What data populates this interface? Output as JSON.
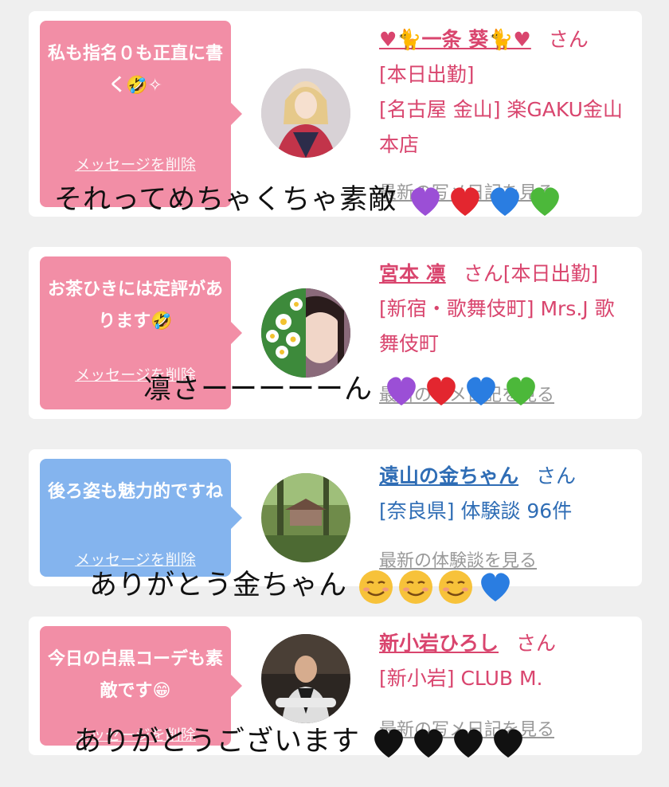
{
  "cards": [
    {
      "message": "私も指名０も正直に書く🤣✧",
      "delete_label": "メッセージを削除",
      "name": "♥🐈一条 葵🐈♥",
      "suffix": "さん",
      "status": "[本日出勤]",
      "location": "[名古屋 金山] 楽GAKU金山本店",
      "link": "最新の写メ日記を見る",
      "bubble_color": "#f28ea6"
    },
    {
      "message": "お茶ひきには定評があります🤣",
      "delete_label": "メッセージを削除",
      "name": "宮本 凛",
      "suffix": "さん",
      "status": "[本日出勤]",
      "location": "[新宿・歌舞伎町] Mrs.J 歌舞伎町",
      "link": "最新の写メ日記を見る",
      "bubble_color": "#f28ea6"
    },
    {
      "message": "後ろ姿も魅力的ですね",
      "delete_label": "メッセージを削除",
      "name": "遠山の金ちゃん",
      "suffix": "さん",
      "location": "[奈良県] 体験談 96件",
      "link": "最新の体験談を見る",
      "bubble_color": "#84b4ee"
    },
    {
      "message": "今日の白黒コーデも素敵です😁",
      "delete_label": "メッセージを削除",
      "name": "新小岩ひろし",
      "suffix": "さん",
      "location": "[新小岩] CLUB M.",
      "link": "最新の写メ日記を見る",
      "bubble_color": "#f28ea6"
    }
  ],
  "overlays": {
    "o1": "それってめちゃくちゃ素敵",
    "o2": "凛さーーーーーん",
    "o3": "ありがとう金ちゃん",
    "o4": "ありがとうございます"
  },
  "colors": {
    "pink_text": "#d9456e",
    "blue_text": "#2f6db5",
    "purple_heart": "#9b4fd6",
    "red_heart": "#e3262f",
    "blue_heart": "#2a7de1",
    "green_heart": "#4cb83a",
    "black_heart": "#111111"
  }
}
